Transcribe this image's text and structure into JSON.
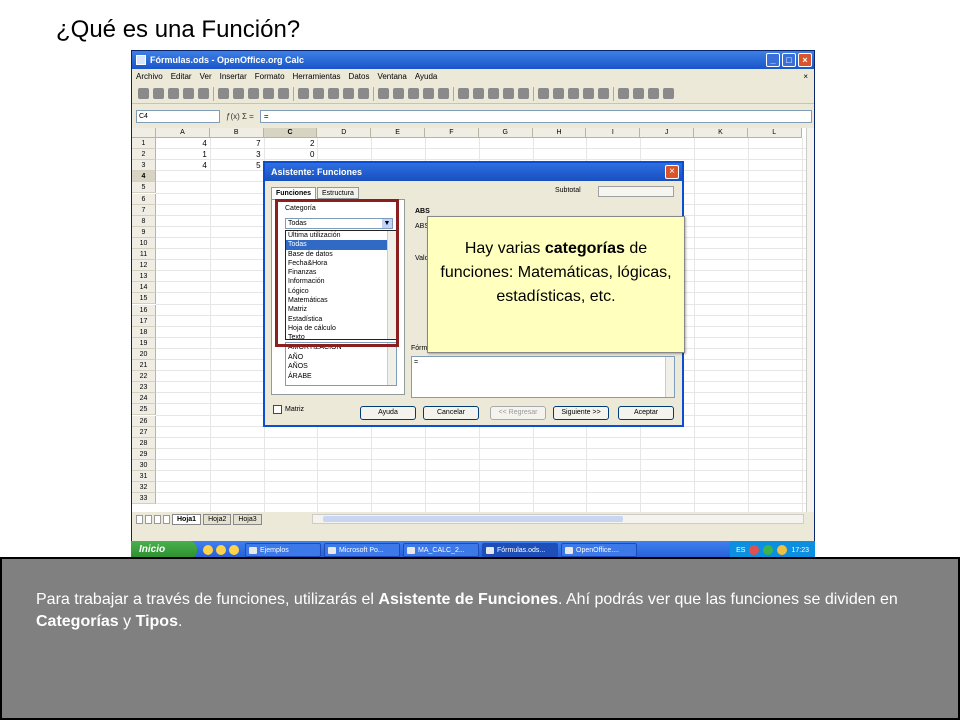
{
  "slide": {
    "title": "¿Qué es una Función?"
  },
  "window": {
    "title": "Fórmulas.ods - OpenOffice.org Calc",
    "menu": [
      "Archivo",
      "Editar",
      "Ver",
      "Insertar",
      "Formato",
      "Herramientas",
      "Datos",
      "Ventana",
      "Ayuda"
    ],
    "menu_close": "×",
    "namebox": "C4",
    "fx_icons": "ƒ(x)  Σ  =",
    "input_line": "="
  },
  "grid": {
    "columns": [
      "A",
      "B",
      "C",
      "D",
      "E",
      "F",
      "G",
      "H",
      "I",
      "J",
      "K",
      "L"
    ],
    "selected_column": "C",
    "rows": [
      "1",
      "2",
      "3",
      "4",
      "5",
      "6",
      "7",
      "8",
      "9",
      "10",
      "11",
      "12",
      "13",
      "14",
      "15",
      "16",
      "17",
      "18",
      "19",
      "20",
      "21",
      "22",
      "23",
      "24",
      "25",
      "26",
      "27",
      "28",
      "29",
      "30",
      "31",
      "32",
      "33"
    ],
    "selected_row": "4",
    "cells": [
      {
        "row": "1",
        "col": "A",
        "value": "4"
      },
      {
        "row": "1",
        "col": "B",
        "value": "7"
      },
      {
        "row": "1",
        "col": "C",
        "value": "2"
      },
      {
        "row": "2",
        "col": "A",
        "value": "1"
      },
      {
        "row": "2",
        "col": "B",
        "value": "3"
      },
      {
        "row": "2",
        "col": "C",
        "value": "0"
      },
      {
        "row": "3",
        "col": "A",
        "value": "4"
      },
      {
        "row": "3",
        "col": "B",
        "value": "5"
      }
    ]
  },
  "sheet_tabs": [
    "Hoja1",
    "Hoja2",
    "Hoja3"
  ],
  "active_sheet": "Hoja1",
  "taskbar": {
    "start": "Inicio",
    "tasks": [
      "Ejemplos",
      "Microsoft Po...",
      "MA_CALC_2...",
      "Fórmulas.ods...",
      "OpenOffice...."
    ],
    "active_task": "Fórmulas.ods...",
    "lang": "ES",
    "clock": "17:23"
  },
  "dialog": {
    "title": "Asistente: Funciones",
    "tabs": [
      "Funciones",
      "Estructura"
    ],
    "category_label": "Categoría",
    "category_value": "Todas",
    "category_options": [
      "Última utilización",
      "Todas",
      "Base de datos",
      "Fecha&Hora",
      "Finanzas",
      "Información",
      "Lógico",
      "Matemáticas",
      "Matriz",
      "Estadística",
      "Hoja de cálculo",
      "Texto"
    ],
    "selected_category": "Todas",
    "functions": [
      "AMORTIZACION",
      "AÑO",
      "AÑOS",
      "ÁRABE"
    ],
    "subtotal_label": "Subtotal",
    "func_name": "ABS",
    "func_syntax": "ABS",
    "value_label": "Valo",
    "formula_label": "Fórm",
    "formula_value": "=",
    "matrix_label": "Matriz",
    "buttons": {
      "help": "Ayuda",
      "cancel": "Cancelar",
      "back": "<< Regresar",
      "next": "Siguiente >>",
      "ok": "Aceptar"
    }
  },
  "callout": {
    "text_before": "Hay varias ",
    "text_bold": "categorías",
    "text_after": " de funciones: Matemáticas, lógicas, estadísticas, etc."
  },
  "info": {
    "p1": "Para trabajar a través de funciones, utilizarás el ",
    "b1": "Asistente de Funciones",
    "p2": ". Ahí podrás ver que las funciones se dividen en ",
    "b2": "Categorías",
    "p3": " y ",
    "b3": "Tipos",
    "p4": "."
  }
}
